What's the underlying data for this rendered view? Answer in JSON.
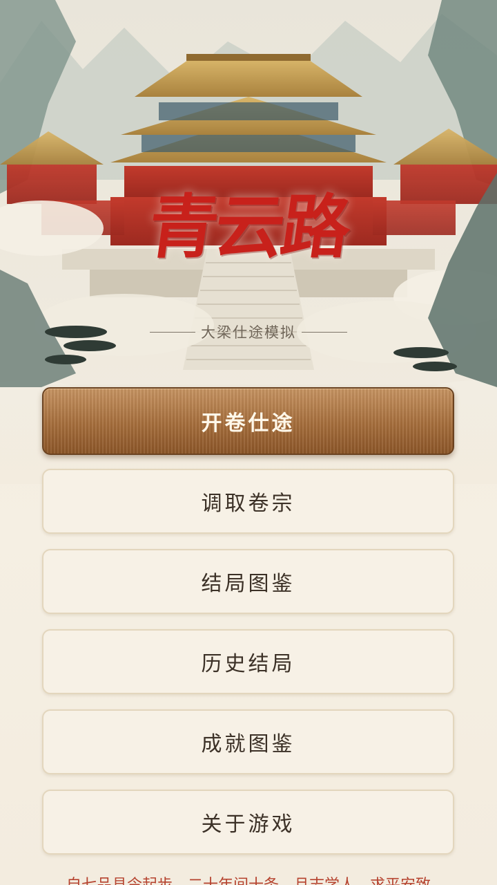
{
  "title": "青云路",
  "subtitle": "大梁仕途模拟",
  "colors": {
    "title_red": "#c8211b",
    "primary_button": "#a66e3c",
    "secondary_button": "#f7f1e6",
    "footer_text": "#b5422e"
  },
  "menu": {
    "start": "开卷仕途",
    "load": "调取卷宗",
    "endings_gallery": "结局图鉴",
    "history": "历史结局",
    "achievements": "成就图鉴",
    "about": "关于游戏"
  },
  "footer": "自七品县令起步，二十年间十条，且志学人，求平安致"
}
